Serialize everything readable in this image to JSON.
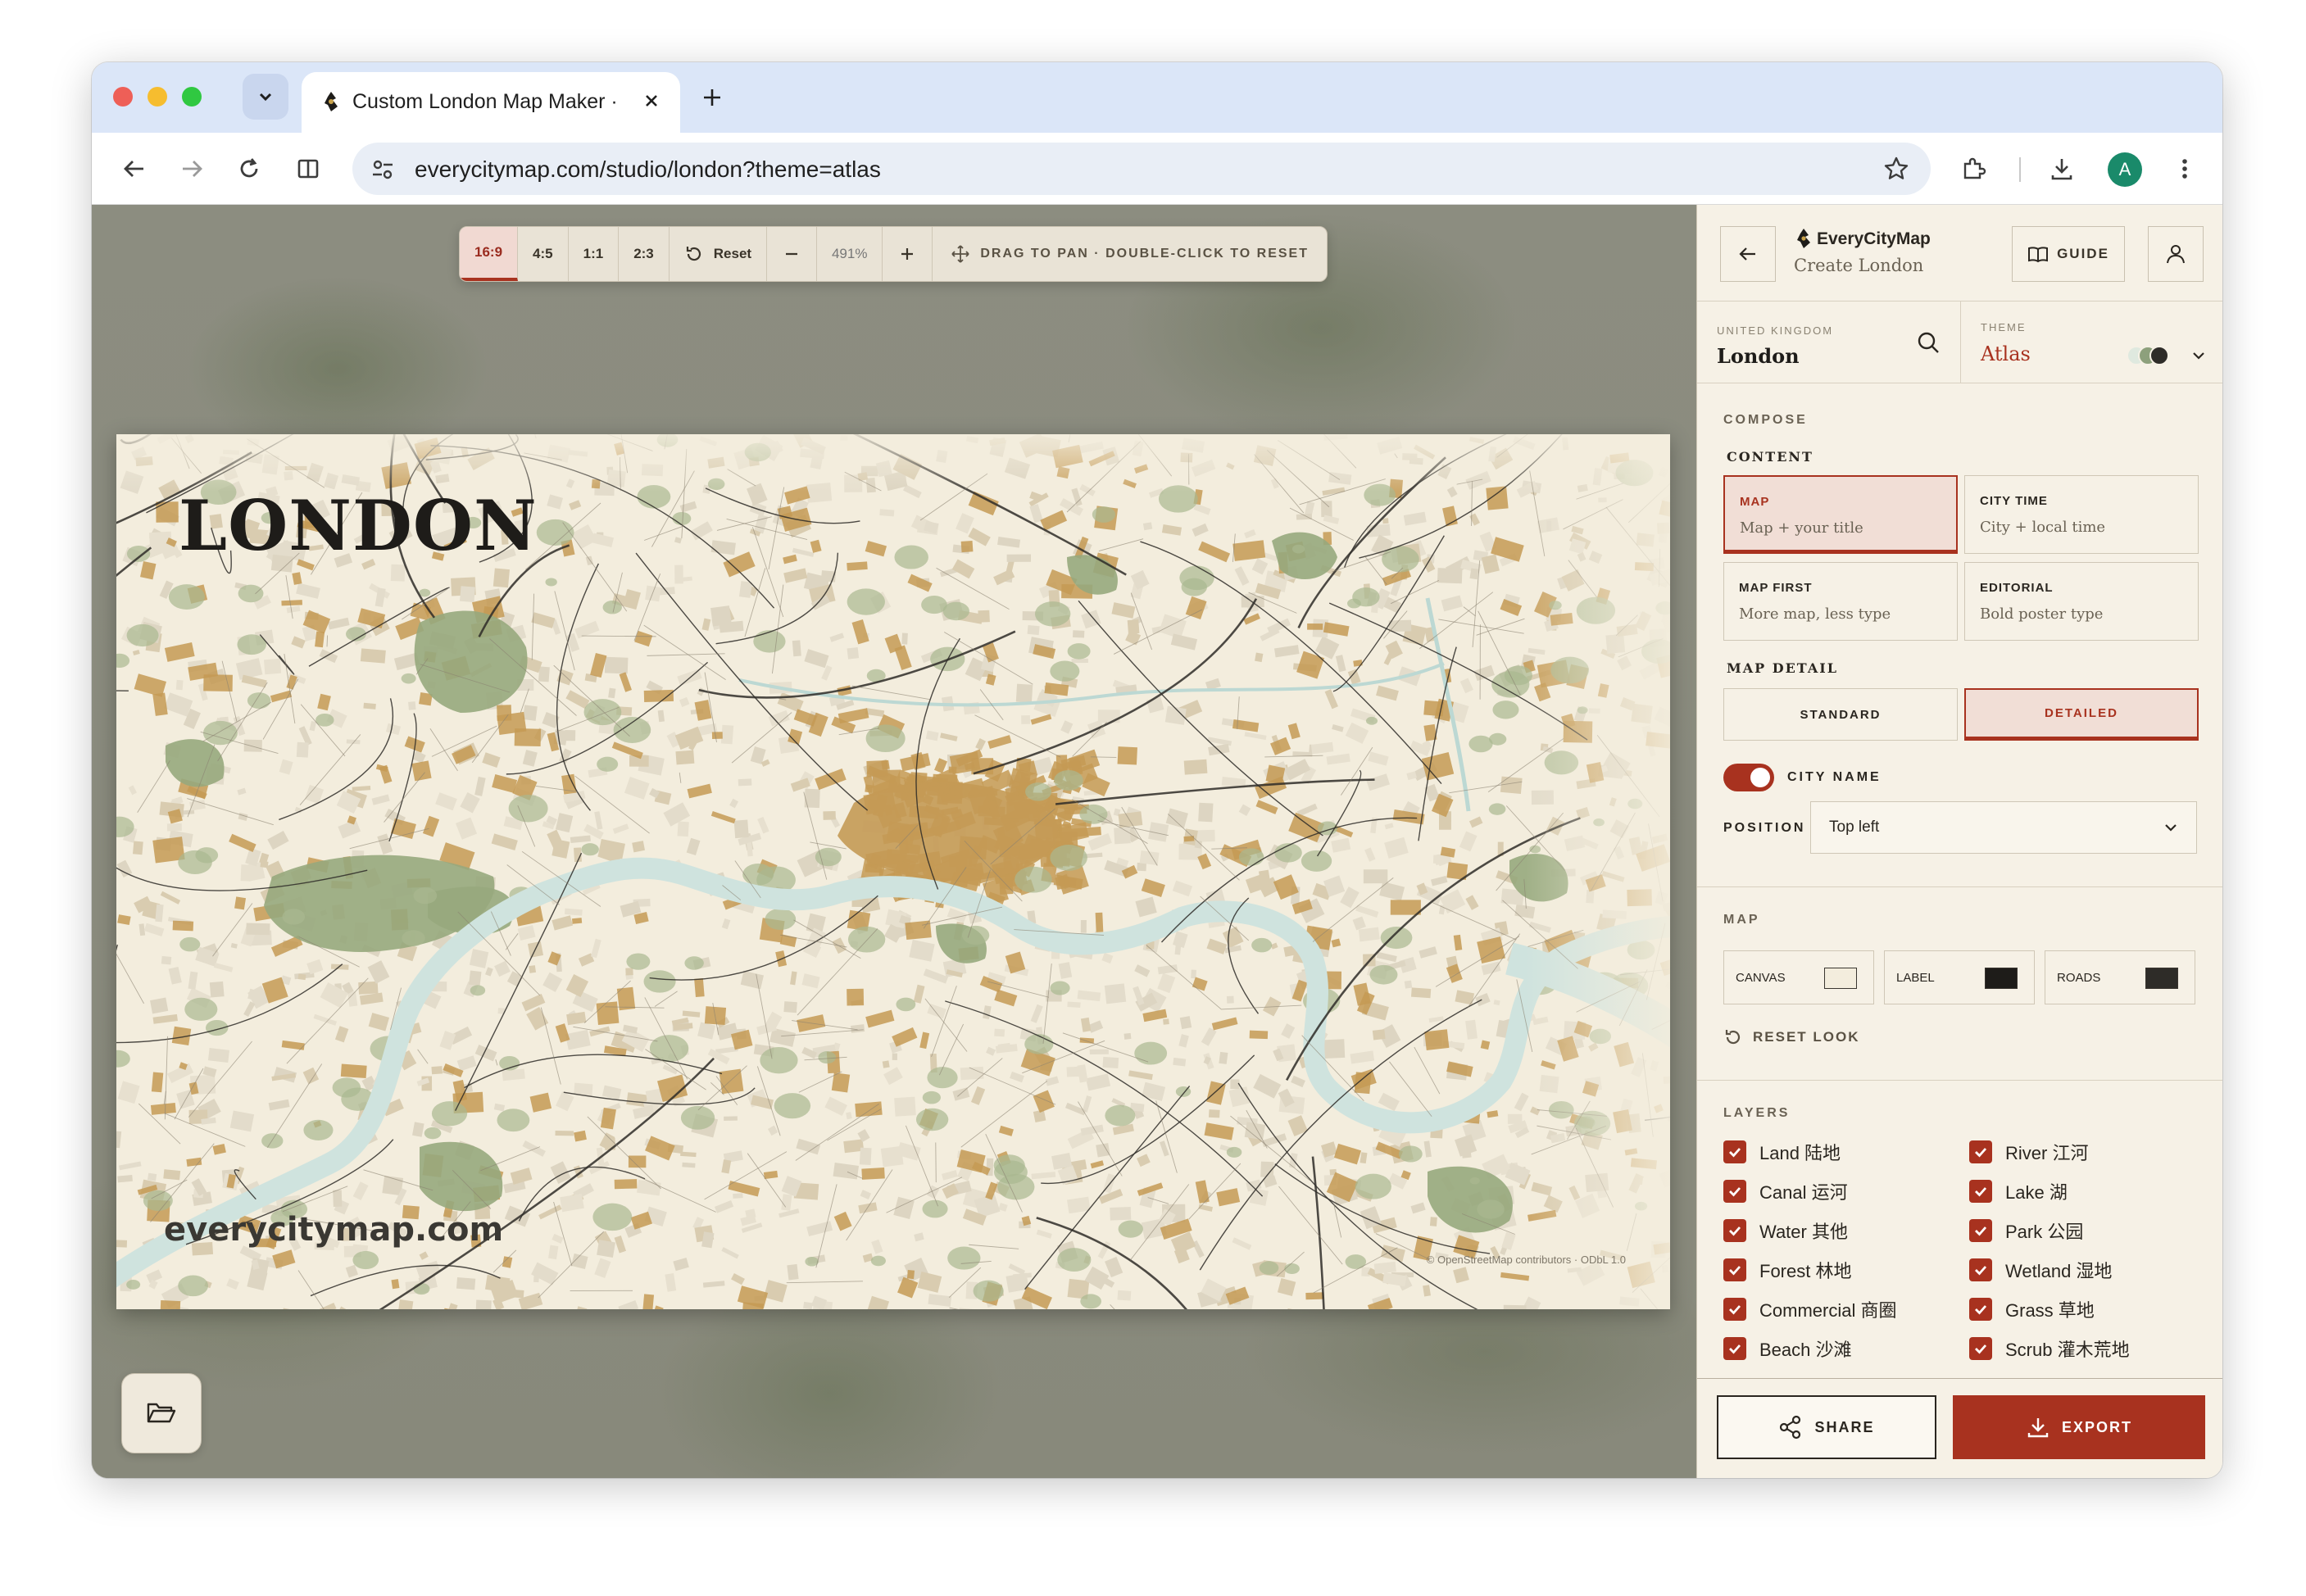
{
  "browser": {
    "tab_title": "Custom London Map Maker · EveryCityMap",
    "url": "everycitymap.com/studio/london?theme=atlas",
    "avatar_letter": "A"
  },
  "controls": {
    "ratios": [
      "16:9",
      "4:5",
      "1:1",
      "2:3"
    ],
    "active_ratio": "16:9",
    "reset_label": "Reset",
    "zoom_value": "491%",
    "hint": "DRAG TO PAN · DOUBLE-CLICK TO RESET"
  },
  "poster": {
    "city_name": "LONDON",
    "brand": "everycitymap.com",
    "attribution": "© OpenStreetMap contributors · ODbL 1.0"
  },
  "panel": {
    "logo_name": "EveryCityMap",
    "logo_sub": "Create London",
    "guide_label": "GUIDE",
    "country_label": "UNITED KINGDOM",
    "city_value": "London",
    "theme_label": "THEME",
    "theme_value": "Atlas",
    "theme_swatches": [
      "#dfe9df",
      "#8da07c",
      "#2e2c28"
    ],
    "compose_title": "COMPOSE",
    "content_title": "CONTENT",
    "content_cards": [
      {
        "title": "MAP",
        "desc": "Map + your title",
        "active": true
      },
      {
        "title": "CITY TIME",
        "desc": "City + local time",
        "active": false
      },
      {
        "title": "MAP FIRST",
        "desc": "More map, less type",
        "active": false
      },
      {
        "title": "EDITORIAL",
        "desc": "Bold poster type",
        "active": false
      }
    ],
    "detail_title": "MAP DETAIL",
    "detail_options": [
      {
        "label": "STANDARD",
        "active": false
      },
      {
        "label": "DETAILED",
        "active": true
      }
    ],
    "city_name_toggle_label": "CITY NAME",
    "city_name_toggle_on": true,
    "position_label": "POSITION",
    "position_value": "Top left",
    "map_title": "MAP",
    "colors": [
      {
        "label": "CANVAS",
        "color": "#f3eddd"
      },
      {
        "label": "LABEL",
        "color": "#1e1c19"
      },
      {
        "label": "ROADS",
        "color": "#2e2c28"
      }
    ],
    "reset_look_label": "RESET LOOK",
    "layers_title": "LAYERS",
    "layers": [
      {
        "label": "Land 陆地",
        "checked": true
      },
      {
        "label": "River 江河",
        "checked": true
      },
      {
        "label": "Canal 运河",
        "checked": true
      },
      {
        "label": "Lake 湖",
        "checked": true
      },
      {
        "label": "Water 其他",
        "checked": true
      },
      {
        "label": "Park 公园",
        "checked": true
      },
      {
        "label": "Forest 林地",
        "checked": true
      },
      {
        "label": "Wetland 湿地",
        "checked": true
      },
      {
        "label": "Commercial 商圈",
        "checked": true
      },
      {
        "label": "Grass 草地",
        "checked": true
      },
      {
        "label": "Beach 沙滩",
        "checked": true
      },
      {
        "label": "Scrub 灌木荒地",
        "checked": true
      }
    ],
    "share_label": "SHARE",
    "export_label": "EXPORT"
  }
}
